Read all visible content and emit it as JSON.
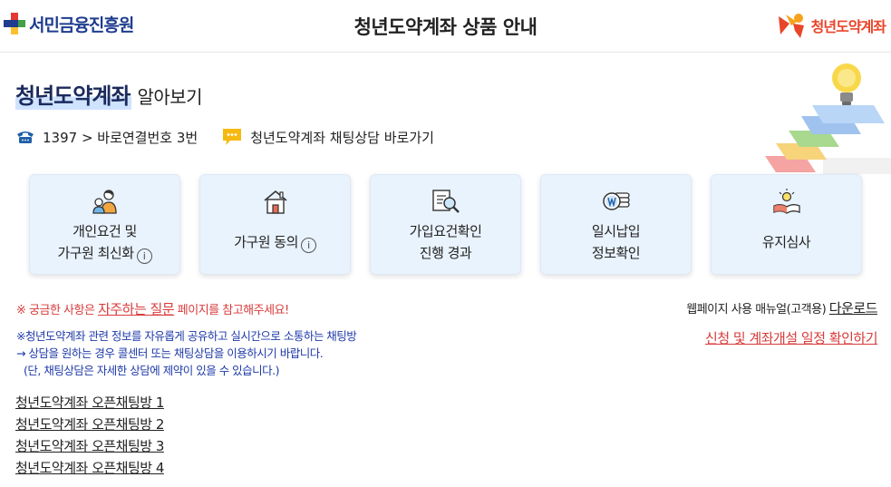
{
  "header": {
    "left_logo_text": "서민금융진흥원",
    "title": "청년도약계좌 상품 안내",
    "right_logo_text": "청년도약계좌"
  },
  "intro": {
    "heading_strong": "청년도약계좌",
    "heading_rest": "알아보기",
    "phone_text": "1397 > 바로연결번호 3번",
    "chat_text": "청년도약계좌 채팅상담 바로가기"
  },
  "cards": [
    {
      "line1": "개인요건 및",
      "line2": "가구원 최신화",
      "info": "i",
      "icon": "family-icon"
    },
    {
      "line1": "가구원 동의",
      "line2": "",
      "info": "i",
      "icon": "house-icon"
    },
    {
      "line1": "가입요건확인",
      "line2": "진행 경과",
      "info": "",
      "icon": "document-search-icon"
    },
    {
      "line1": "일시납입",
      "line2": "정보확인",
      "info": "",
      "icon": "won-coin-icon"
    },
    {
      "line1": "유지심사",
      "line2": "",
      "info": "",
      "icon": "idea-book-icon"
    }
  ],
  "faq_note": {
    "prefix": "※ 궁금한 사항은 ",
    "link": "자주하는 질문",
    "suffix": " 페이지를 참고해주세요!"
  },
  "manual": {
    "prefix": "웹페이지 사용 매뉴얼(고객용) ",
    "link": "다운로드"
  },
  "schedule_link": "신청 및 계좌개설 일정 확인하기",
  "notice_lines": [
    "※청년도약계좌 관련 정보를 자유롭게 공유하고 실시간으로 소통하는 채팅방",
    "→ 상담을 원하는 경우 콜센터 또는 채팅상담을 이용하시기 바랍니다.",
    "(단, 채팅상담은 자세한 상담에 제약이 있을 수 있습니다.)"
  ],
  "open_chat_rooms": [
    "청년도약계좌 오픈채팅방 1",
    "청년도약계좌 오픈채팅방 2",
    "청년도약계좌 오픈채팅방 3",
    "청년도약계좌 오픈채팅방 4"
  ],
  "colors": {
    "brand_navy": "#1b2a5c",
    "alert_red": "#d83b3b",
    "notice_blue": "#1f3aa8",
    "card_bg": "#e9f3fd"
  }
}
